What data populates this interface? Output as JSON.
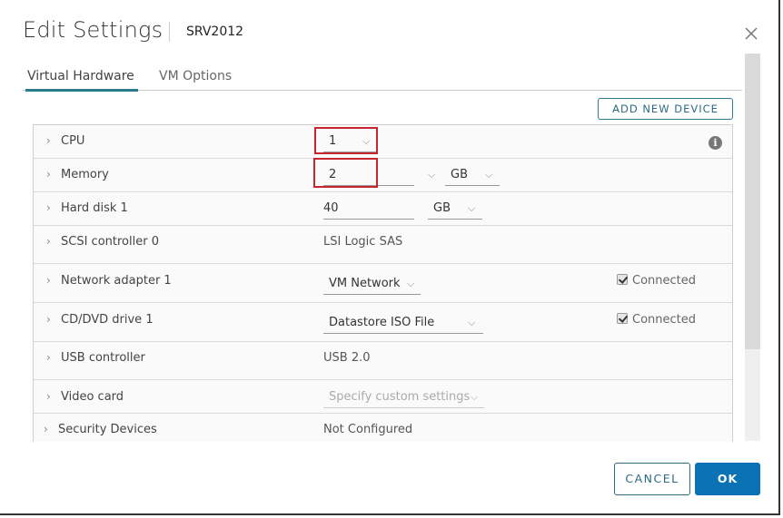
{
  "dialog": {
    "title": "Edit Settings",
    "vm_name": "SRV2012"
  },
  "tabs": [
    {
      "label": "Virtual Hardware",
      "active": true
    },
    {
      "label": "VM Options",
      "active": false
    }
  ],
  "toolbar": {
    "add_new_device_label": "ADD NEW DEVICE"
  },
  "hardware": {
    "cpu": {
      "label": "CPU",
      "value": "1"
    },
    "memory": {
      "label": "Memory",
      "value": "2",
      "unit": "GB"
    },
    "hard_disk": {
      "label": "Hard disk 1",
      "value": "40",
      "unit": "GB"
    },
    "scsi": {
      "label": "SCSI controller 0",
      "value": "LSI Logic SAS"
    },
    "network": {
      "label": "Network adapter 1",
      "value": "VM Network",
      "connected_label": "Connected",
      "connected": true
    },
    "cddvd": {
      "label": "CD/DVD drive 1",
      "value": "Datastore ISO File",
      "connected_label": "Connected",
      "connected": true
    },
    "usb": {
      "label": "USB controller",
      "value": "USB 2.0"
    },
    "video": {
      "label": "Video card",
      "value": "Specify custom settings"
    },
    "security": {
      "label": "Security Devices",
      "value": "Not Configured"
    }
  },
  "icons": {
    "chevron_right": "›",
    "chevron_down": "⌵",
    "info": "i"
  },
  "footer": {
    "cancel_label": "CANCEL",
    "ok_label": "OK"
  },
  "colors": {
    "accent": "#2b7a8f",
    "primary_button": "#0b72b5",
    "highlight": "#c6262e"
  }
}
